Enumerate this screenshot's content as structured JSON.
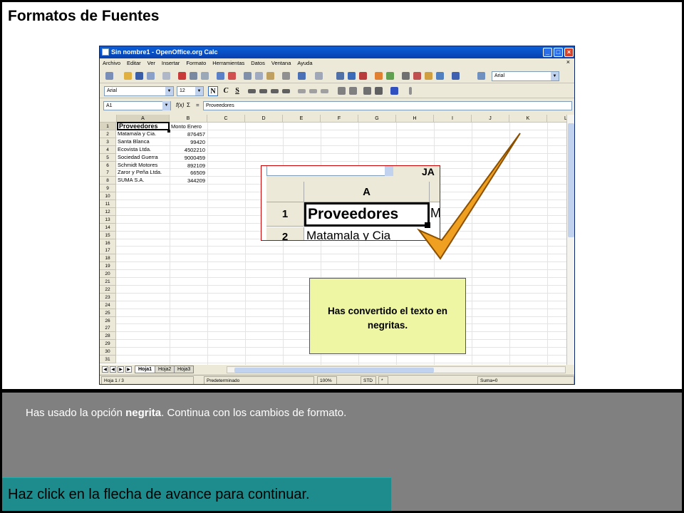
{
  "slide": {
    "title": "Formatos de Fuentes",
    "instruction_prefix": "Has usado la opción ",
    "instruction_bold": "negrita",
    "instruction_suffix": ". Continua con los cambios de formato.",
    "advance_text": "Haz click en la flecha de avance para continuar.",
    "message": "Has convertido el texto en negritas."
  },
  "window": {
    "title": "Sin nombre1 - OpenOffice.org Calc",
    "menu": [
      "Archivo",
      "Editar",
      "Ver",
      "Insertar",
      "Formato",
      "Herramientas",
      "Datos",
      "Ventana",
      "Ayuda"
    ],
    "toolbar_font": "Arial",
    "font_name": "Arial",
    "font_size": "12",
    "bold_label": "N",
    "italic_label": "C",
    "underline_label": "S",
    "name_box": "A1",
    "sigma": "Σ",
    "equals": "=",
    "fx": "f(x)",
    "formula_value": "Proveedores"
  },
  "sheet": {
    "columns": [
      "A",
      "B",
      "C",
      "D",
      "E",
      "F",
      "G",
      "H",
      "I",
      "J",
      "K",
      "L"
    ],
    "rows": [
      "1",
      "2",
      "3",
      "4",
      "5",
      "6",
      "7",
      "8",
      "9",
      "10",
      "11",
      "12",
      "13",
      "14",
      "15",
      "16",
      "17",
      "18",
      "19",
      "20",
      "21",
      "22",
      "23",
      "24",
      "25",
      "26",
      "27",
      "28",
      "29",
      "30",
      "31"
    ],
    "col_a": [
      "Proveedores",
      "Matamala y Cia.",
      "Santa Blanca",
      "Ecovista Ltda.",
      "Sociedad Guerra",
      "Schmidt Motores",
      "Zaror y Peña Ltda.",
      "SUMA S.A."
    ],
    "col_b": [
      "Monto Enero",
      "876457",
      "99420",
      "4502210",
      "9000459",
      "892109",
      "66509",
      "344209"
    ],
    "tabs": [
      "Hoja1",
      "Hoja2",
      "Hoja3"
    ]
  },
  "status": {
    "sheet": "Hoja 1 / 3",
    "style": "Predeterminado",
    "zoom": "100%",
    "mode": "STD",
    "modified": "*",
    "sum": "Suma=0"
  },
  "zoom": {
    "col": "A",
    "row1": "1",
    "row2": "2",
    "cell": "Proveedores",
    "row2_text": "Matamala y Cia",
    "partial_b": "M",
    "partial_top": "JA"
  },
  "colors": {
    "accent_checkmark": "#f0a020",
    "message_bg": "#eef5a3",
    "advance_bg": "#1e8c8c",
    "panel_bg": "#808080"
  }
}
